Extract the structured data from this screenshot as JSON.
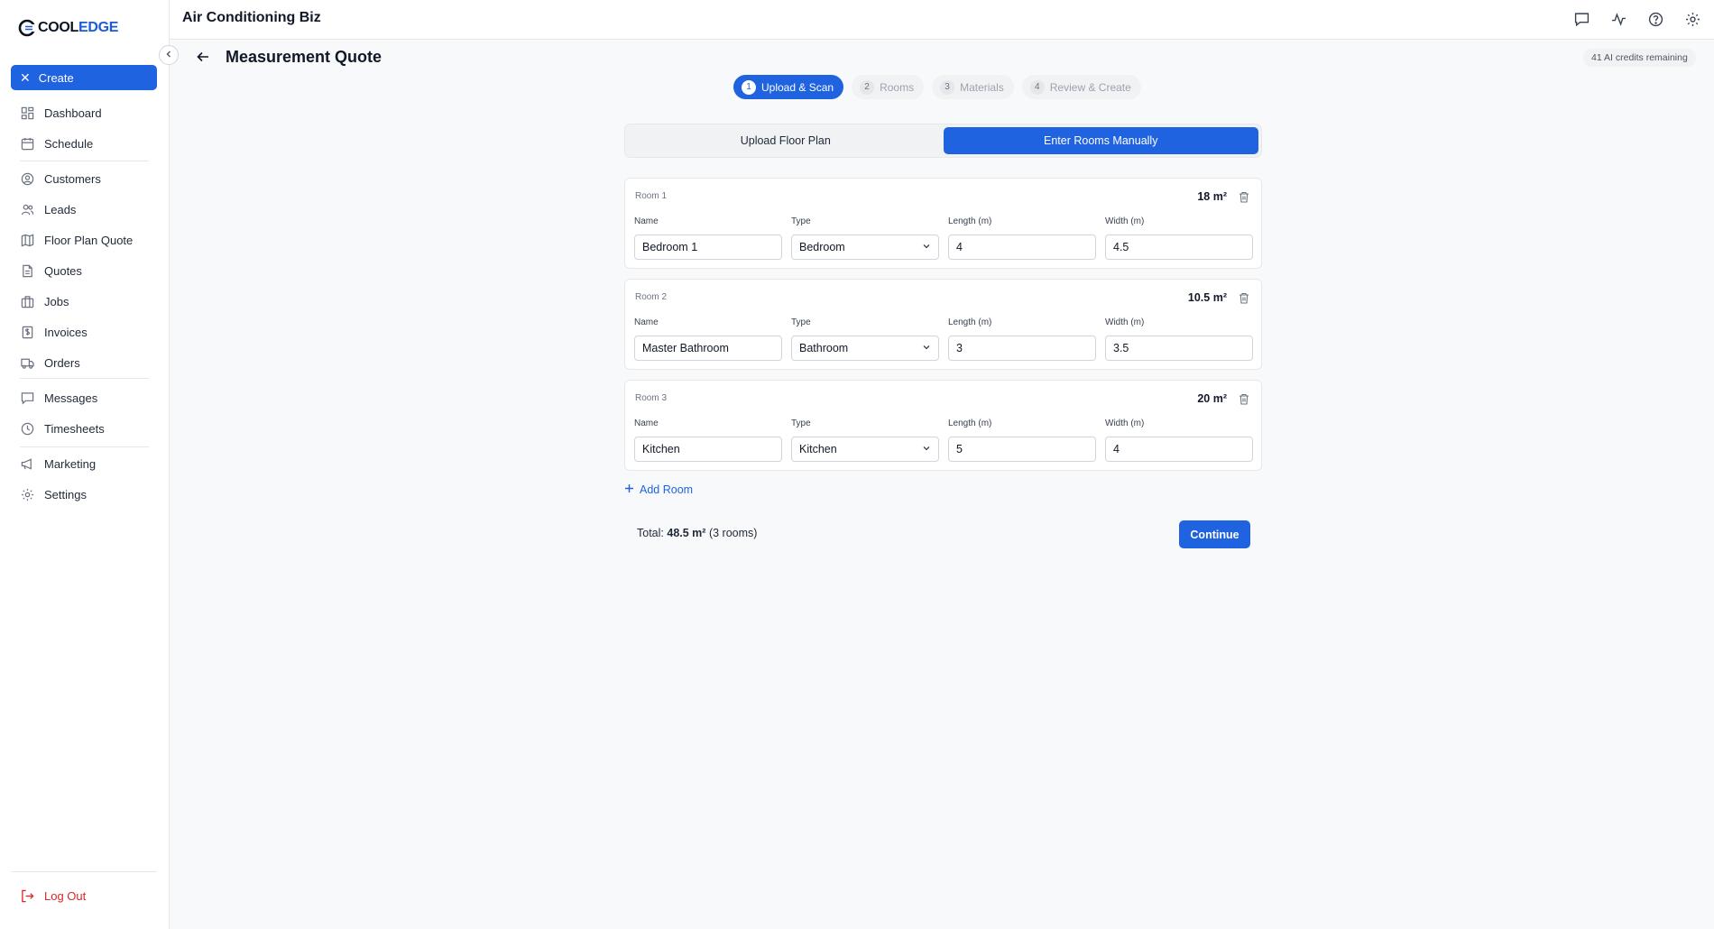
{
  "brand": {
    "logo_part1": "COOL",
    "logo_part2": "EDGE",
    "accent": "#1f63e0",
    "danger": "#dc2626"
  },
  "sidebar": {
    "create_label": "Create",
    "items": [
      {
        "label": "Dashboard",
        "icon": "dashboard-icon"
      },
      {
        "label": "Schedule",
        "icon": "calendar-icon"
      },
      {
        "label": "Customers",
        "icon": "user-circle-icon"
      },
      {
        "label": "Leads",
        "icon": "users-icon"
      },
      {
        "label": "Floor Plan Quote",
        "icon": "map-icon"
      },
      {
        "label": "Quotes",
        "icon": "document-icon"
      },
      {
        "label": "Jobs",
        "icon": "briefcase-icon"
      },
      {
        "label": "Invoices",
        "icon": "receipt-icon"
      },
      {
        "label": "Orders",
        "icon": "truck-icon"
      },
      {
        "label": "Messages",
        "icon": "chat-icon"
      },
      {
        "label": "Timesheets",
        "icon": "clock-icon"
      },
      {
        "label": "Marketing",
        "icon": "megaphone-icon"
      },
      {
        "label": "Settings",
        "icon": "gear-icon"
      }
    ],
    "logout_label": "Log Out"
  },
  "topbar": {
    "title": "Air Conditioning Biz"
  },
  "page": {
    "title": "Measurement Quote",
    "credits": "41 AI credits remaining"
  },
  "steps": [
    {
      "num": "1",
      "label": "Upload & Scan",
      "active": true
    },
    {
      "num": "2",
      "label": "Rooms",
      "active": false
    },
    {
      "num": "3",
      "label": "Materials",
      "active": false
    },
    {
      "num": "4",
      "label": "Review & Create",
      "active": false
    }
  ],
  "mode": {
    "upload_label": "Upload Floor Plan",
    "manual_label": "Enter Rooms Manually",
    "selected": "manual"
  },
  "field_labels": {
    "name": "Name",
    "type": "Type",
    "length": "Length (m)",
    "width": "Width (m)"
  },
  "rooms": [
    {
      "label": "Room 1",
      "area": "18 m²",
      "name": "Bedroom 1",
      "type": "Bedroom",
      "length": "4",
      "width": "4.5"
    },
    {
      "label": "Room 2",
      "area": "10.5 m²",
      "name": "Master Bathroom",
      "type": "Bathroom",
      "length": "3",
      "width": "3.5"
    },
    {
      "label": "Room 3",
      "area": "20 m²",
      "name": "Kitchen",
      "type": "Kitchen",
      "length": "5",
      "width": "4"
    }
  ],
  "add_room_label": "Add Room",
  "summary": {
    "prefix": "Total:",
    "area": "48.5 m²",
    "rooms": "(3 rooms)"
  },
  "continue_label": "Continue"
}
